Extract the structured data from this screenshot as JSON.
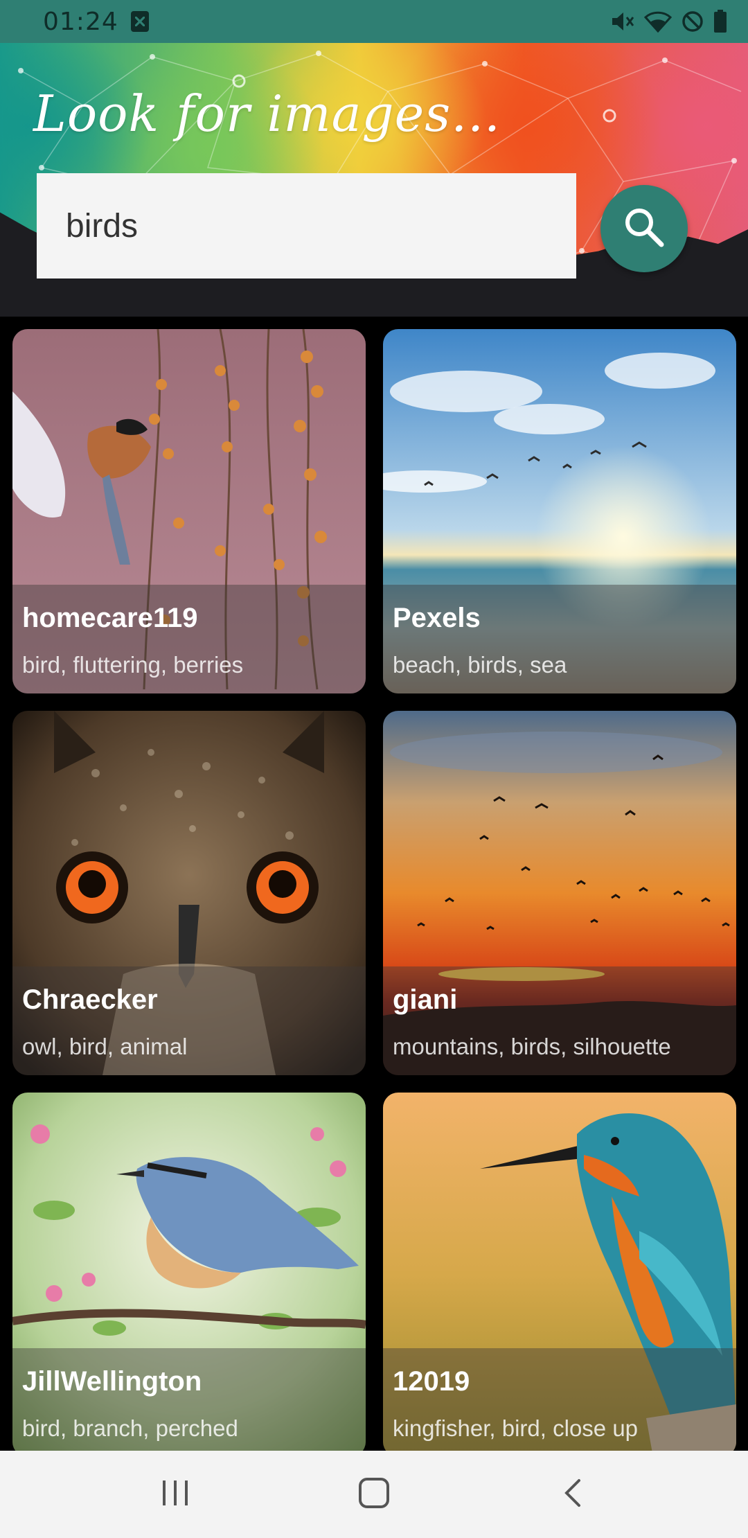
{
  "status_bar": {
    "time": "01:24",
    "icons": [
      "notification-icon",
      "mute-icon",
      "wifi-icon",
      "do-not-disturb-icon",
      "battery-icon"
    ]
  },
  "header": {
    "title": "Look for images...",
    "search_value": "birds",
    "search_icon": "search-icon",
    "accent_color": "#2f7f73"
  },
  "results": [
    {
      "author": "homecare119",
      "tags": "bird, fluttering, berries"
    },
    {
      "author": "Pexels",
      "tags": "beach, birds, sea"
    },
    {
      "author": "Chraecker",
      "tags": "owl, bird, animal"
    },
    {
      "author": "giani",
      "tags": "mountains, birds, silhouette"
    },
    {
      "author": "JillWellington",
      "tags": "bird, branch, perched"
    },
    {
      "author": "12019",
      "tags": "kingfisher, bird, close up"
    }
  ],
  "nav_bar": {
    "icons": [
      "recents-icon",
      "home-icon",
      "back-icon"
    ]
  }
}
